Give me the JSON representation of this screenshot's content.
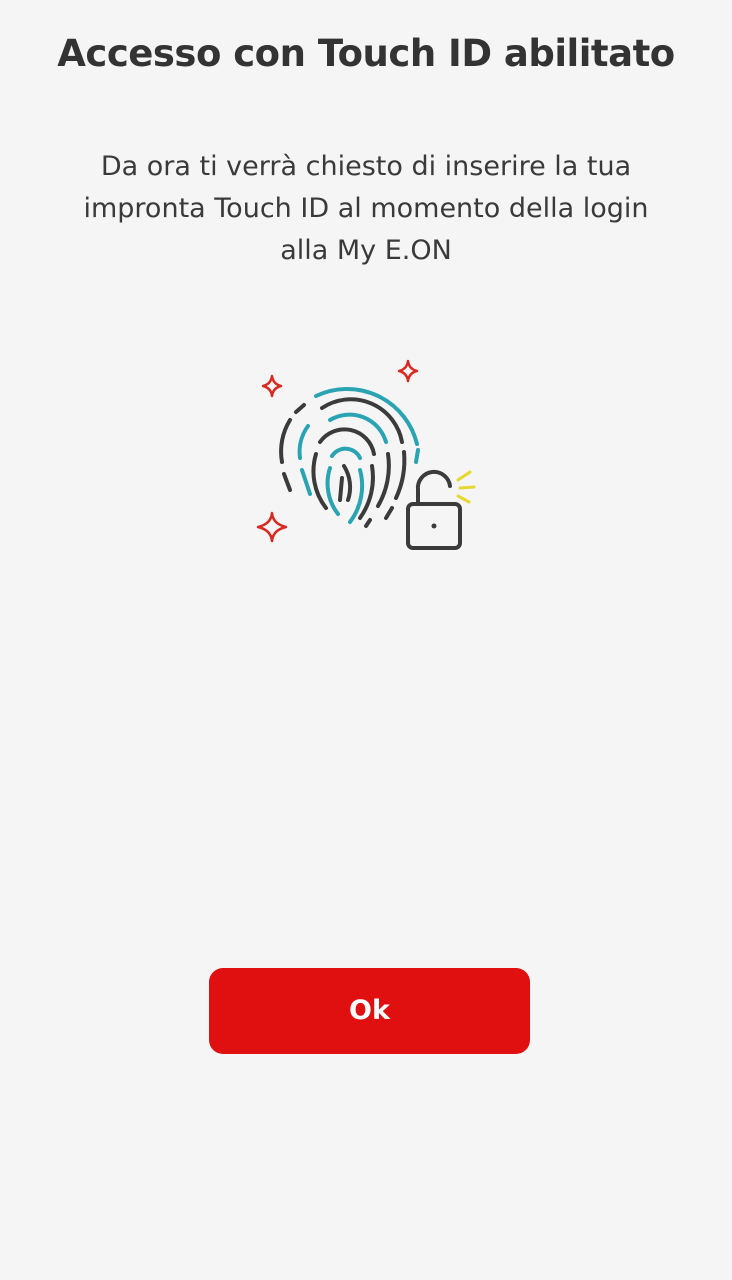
{
  "screen": {
    "title": "Accesso con Touch ID abilitato",
    "description": "Da ora ti verrà chiesto di inserire la tua impronta Touch ID al momento della login alla My E.ON"
  },
  "illustration": {
    "icons": [
      "fingerprint-icon",
      "unlocked-padlock-icon",
      "sparkle-icon"
    ],
    "colors": {
      "fingerprint_dark": "#3b3b3b",
      "fingerprint_teal": "#2aa3b3",
      "sparkle": "#d62a22",
      "lock_glow": "#e5d833"
    }
  },
  "actions": {
    "ok_label": "Ok"
  },
  "colors": {
    "background": "#f5f5f5",
    "primary_button": "#e01010",
    "text": "#333333"
  }
}
